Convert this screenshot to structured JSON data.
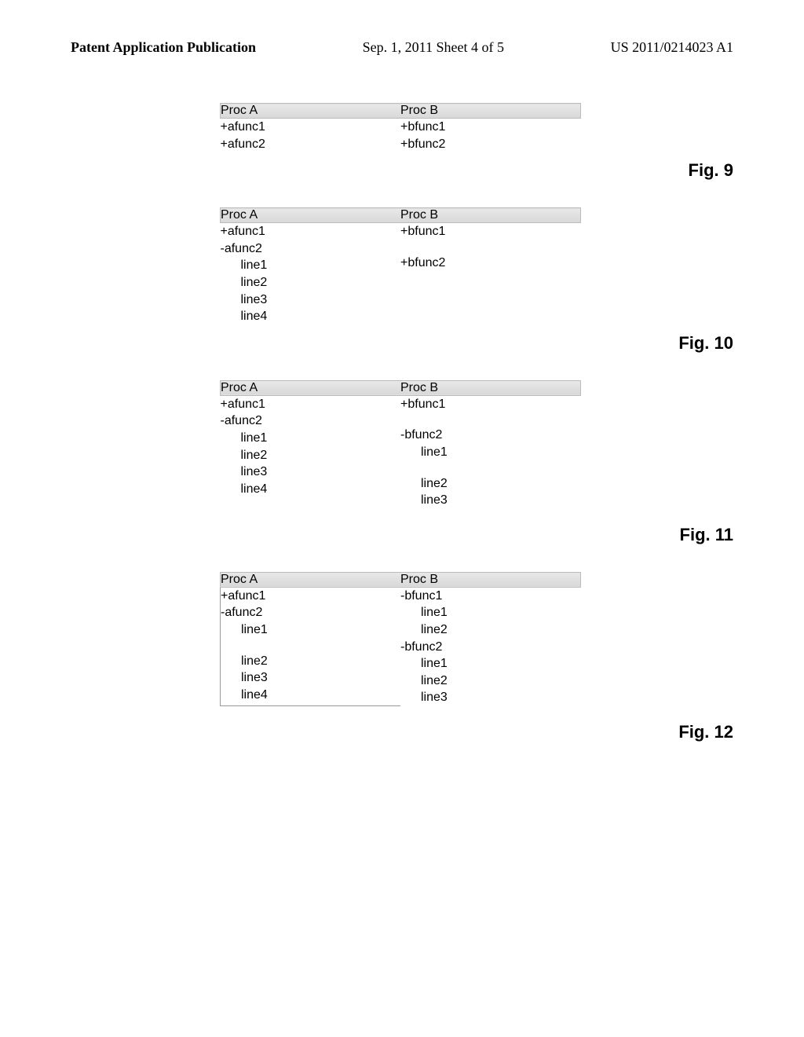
{
  "header": {
    "left": "Patent Application Publication",
    "center": "Sep. 1, 2011  Sheet 4 of 5",
    "right": "US 2011/0214023 A1"
  },
  "figures": {
    "fig9": {
      "caption": "Fig. 9",
      "procA": {
        "header": "Proc A",
        "lines": [
          "+afunc1",
          "+afunc2"
        ]
      },
      "procB": {
        "header": "Proc B",
        "lines": [
          "+bfunc1",
          "+bfunc2"
        ]
      }
    },
    "fig10": {
      "caption": "Fig. 10",
      "procA": {
        "header": "Proc A",
        "lines": [
          {
            "t": "+afunc1",
            "indent": 0
          },
          {
            "t": "-afunc2",
            "indent": 0
          },
          {
            "t": "line1",
            "indent": 1
          },
          {
            "t": "line2",
            "indent": 1
          },
          {
            "t": "line3",
            "indent": 1
          },
          {
            "t": "line4",
            "indent": 1
          }
        ]
      },
      "procB": {
        "header": "Proc B",
        "lines": [
          {
            "t": "+bfunc1",
            "indent": 0
          },
          {
            "t": "",
            "indent": 0,
            "gap": true
          },
          {
            "t": "+bfunc2",
            "indent": 0
          }
        ]
      }
    },
    "fig11": {
      "caption": "Fig. 11",
      "procA": {
        "header": "Proc A",
        "lines": [
          {
            "t": "+afunc1",
            "indent": 0
          },
          {
            "t": "-afunc2",
            "indent": 0
          },
          {
            "t": "line1",
            "indent": 1
          },
          {
            "t": "line2",
            "indent": 1
          },
          {
            "t": "line3",
            "indent": 1
          },
          {
            "t": "line4",
            "indent": 1
          }
        ]
      },
      "procB": {
        "header": "Proc B",
        "lines": [
          {
            "t": "+bfunc1",
            "indent": 0
          },
          {
            "t": "",
            "indent": 0,
            "gap": true
          },
          {
            "t": "-bfunc2",
            "indent": 0
          },
          {
            "t": "line1",
            "indent": 1
          },
          {
            "t": "",
            "indent": 0,
            "gap": true
          },
          {
            "t": "line2",
            "indent": 1
          },
          {
            "t": "line3",
            "indent": 1
          }
        ]
      }
    },
    "fig12": {
      "caption": "Fig. 12",
      "procA": {
        "header": "Proc A",
        "lines": [
          {
            "t": "+afunc1",
            "indent": 0
          },
          {
            "t": "-afunc2",
            "indent": 0
          },
          {
            "t": "line1",
            "indent": 1
          },
          {
            "t": "",
            "indent": 0,
            "gap": true
          },
          {
            "t": "line2",
            "indent": 1
          },
          {
            "t": "line3",
            "indent": 1
          },
          {
            "t": "line4",
            "indent": 1
          }
        ]
      },
      "procB": {
        "header": "Proc B",
        "lines": [
          {
            "t": "-bfunc1",
            "indent": 0
          },
          {
            "t": "line1",
            "indent": 1
          },
          {
            "t": "line2",
            "indent": 1
          },
          {
            "t": "-bfunc2",
            "indent": 0
          },
          {
            "t": "line1",
            "indent": 1
          },
          {
            "t": "line2",
            "indent": 1
          },
          {
            "t": "line3",
            "indent": 1
          }
        ]
      }
    }
  }
}
